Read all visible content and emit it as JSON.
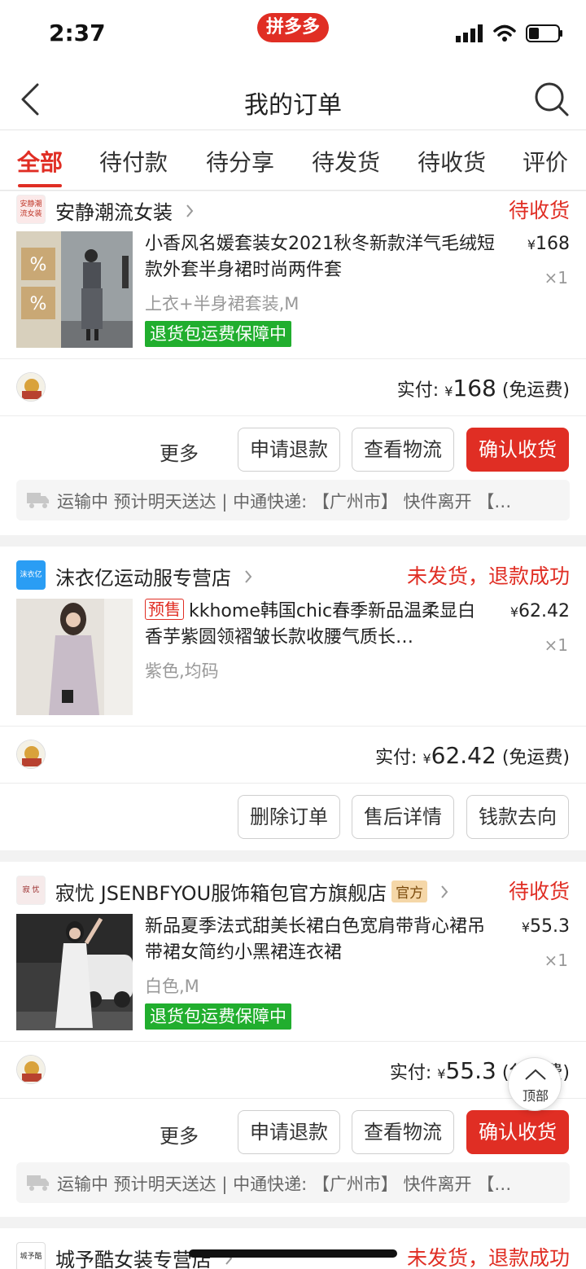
{
  "status_bar": {
    "time": "2:37",
    "brand": "拼多多"
  },
  "nav": {
    "title": "我的订单"
  },
  "tabs": [
    {
      "label": "全部"
    },
    {
      "label": "待付款"
    },
    {
      "label": "待分享"
    },
    {
      "label": "待发货"
    },
    {
      "label": "待收货"
    },
    {
      "label": "评价"
    }
  ],
  "orders": [
    {
      "shop_name": "安静潮流女装",
      "shop_logo_text": "安静潮流女装",
      "status": "待收货",
      "title": "小香风名媛套装女2021秋冬新款洋气毛绒短款外套半身裙时尚两件套",
      "price": "168",
      "qty": "×1",
      "spec": "上衣+半身裙套装,M",
      "badge": "退货包运费保障中",
      "paid_label": "实付:",
      "paid_amount": "168",
      "shipping": "(免运费)",
      "buttons": [
        "更多",
        "申请退款",
        "查看物流",
        "确认收货"
      ],
      "logistics": "运输中 预计明天送达 | 中通快递: 【广州市】 快件离开 【…"
    },
    {
      "shop_name": "沫衣亿运动服专营店",
      "shop_logo_text": "沫衣亿",
      "status": "未发货，退款成功",
      "presale": "预售",
      "title": "kkhome韩国chic春季新品温柔显白香芋紫圆领褶皱长款收腰气质长…",
      "price": "62.42",
      "qty": "×1",
      "spec": "紫色,均码",
      "paid_label": "实付:",
      "paid_amount": "62.42",
      "shipping": "(免运费)",
      "buttons": [
        "删除订单",
        "售后详情",
        "钱款去向"
      ]
    },
    {
      "shop_name": "寂忧 JSENBFYOU服饰箱包官方旗舰店",
      "shop_logo_text": "寂 忧",
      "official": "官方",
      "status": "待收货",
      "title": "新品夏季法式甜美长裙白色宽肩带背心裙吊带裙女简约小黑裙连衣裙",
      "price": "55.3",
      "qty": "×1",
      "spec": "白色,M",
      "badge": "退货包运费保障中",
      "paid_label": "实付:",
      "paid_amount": "55.3",
      "shipping": "(免运费)",
      "buttons": [
        "更多",
        "申请退款",
        "查看物流",
        "确认收货"
      ],
      "logistics": "运输中 预计明天送达 | 中通快递: 【广州市】 快件离开 【…"
    },
    {
      "shop_name": "城予酷女装专营店",
      "shop_logo_text": "城予酷",
      "status": "未发货，退款成功"
    }
  ],
  "back_to_top": "顶部",
  "colors": {
    "accent": "#e02e24",
    "guarantee": "#21ae2e",
    "official_badge": "#f5d7a8"
  }
}
